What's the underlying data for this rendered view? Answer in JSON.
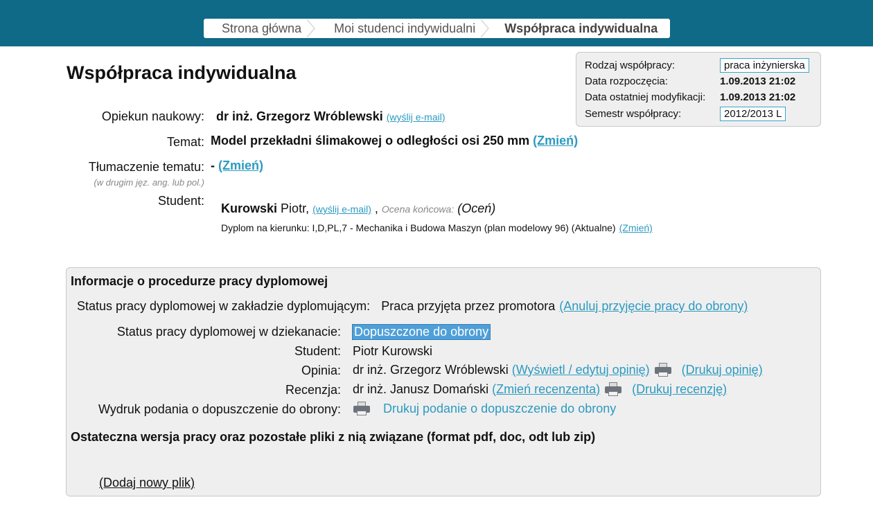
{
  "breadcrumb": [
    "Strona główna",
    "Moi studenci indywidualni",
    "Współpraca indywidualna"
  ],
  "page_title": "Współpraca indywidualna",
  "infobox": {
    "rodzaj_label": "Rodzaj współpracy:",
    "rodzaj_value": "praca inżynierska",
    "data_rozp_label": "Data rozpoczęcia:",
    "data_rozp_value": "1.09.2013 21:02",
    "data_mod_label": "Data ostatniej modyfikacji:",
    "data_mod_value": "1.09.2013 21:02",
    "semestr_label": "Semestr współpracy:",
    "semestr_value": "2012/2013 L"
  },
  "details": {
    "opiekun_label": "Opiekun naukowy:",
    "opiekun_name": "dr inż. Grzegorz Wróblewski",
    "send_email": "(wyślij e-mail)",
    "temat_label": "Temat:",
    "temat_value": "Model przekładni ślimakowej o odległości osi 250 mm",
    "zmien": "(Zmień)",
    "tlumaczenie_label": "Tłumaczenie tematu:",
    "tlumaczenie_sub": "(w drugim jęz. ang. lub pol.)",
    "tlumaczenie_value": "-",
    "student_label": "Student:",
    "student_surname": "Kurowski",
    "student_firstname": "Piotr,",
    "comma": ",",
    "ocena_label": "Ocena końcowa:",
    "ocena_link": "(Oceń)",
    "dyplom_text": "Dyplom na kierunku: I,D,PL,7 - Mechanika i Budowa Maszyn (plan modelowy 96) (Aktualne)"
  },
  "procedure": {
    "heading": "Informacje o procedurze pracy dyplomowej",
    "status_zaklad_label": "Status pracy dyplomowej w zakładzie dyplomującym:",
    "status_zaklad_value": "Praca przyjęta przez promotora",
    "status_zaklad_link": "(Anuluj przyjęcie pracy do obrony)",
    "status_dziekanat_label": "Status pracy dyplomowej w dziekanacie:",
    "status_dziekanat_value": "Dopuszczone do obrony",
    "student_label": "Student:",
    "student_value": "Piotr Kurowski",
    "opinia_label": "Opinia:",
    "opinia_value": "dr inż. Grzegorz Wróblewski",
    "opinia_link": "(Wyświetl / edytuj opinię)",
    "opinia_print": "(Drukuj opinię)",
    "recenzja_label": "Recenzja:",
    "recenzja_value": "dr inż. Janusz Domański",
    "recenzja_link": "(Zmień recenzenta)",
    "recenzja_print": "(Drukuj recenzję)",
    "wydruk_label": "Wydruk podania o dopuszczenie do obrony:",
    "wydruk_link": "Drukuj podanie o dopuszczenie do obrony",
    "files_heading": "Ostateczna wersja pracy oraz pozostałe pliki z nią związane (format pdf, doc, odt lub zip)",
    "add_file": "(Dodaj nowy plik)"
  },
  "colors": {
    "topbar": "#0f6a87",
    "link": "#2d9ac0",
    "highlight": "#4f9fd8"
  },
  "icons": [
    "printer-icon"
  ]
}
